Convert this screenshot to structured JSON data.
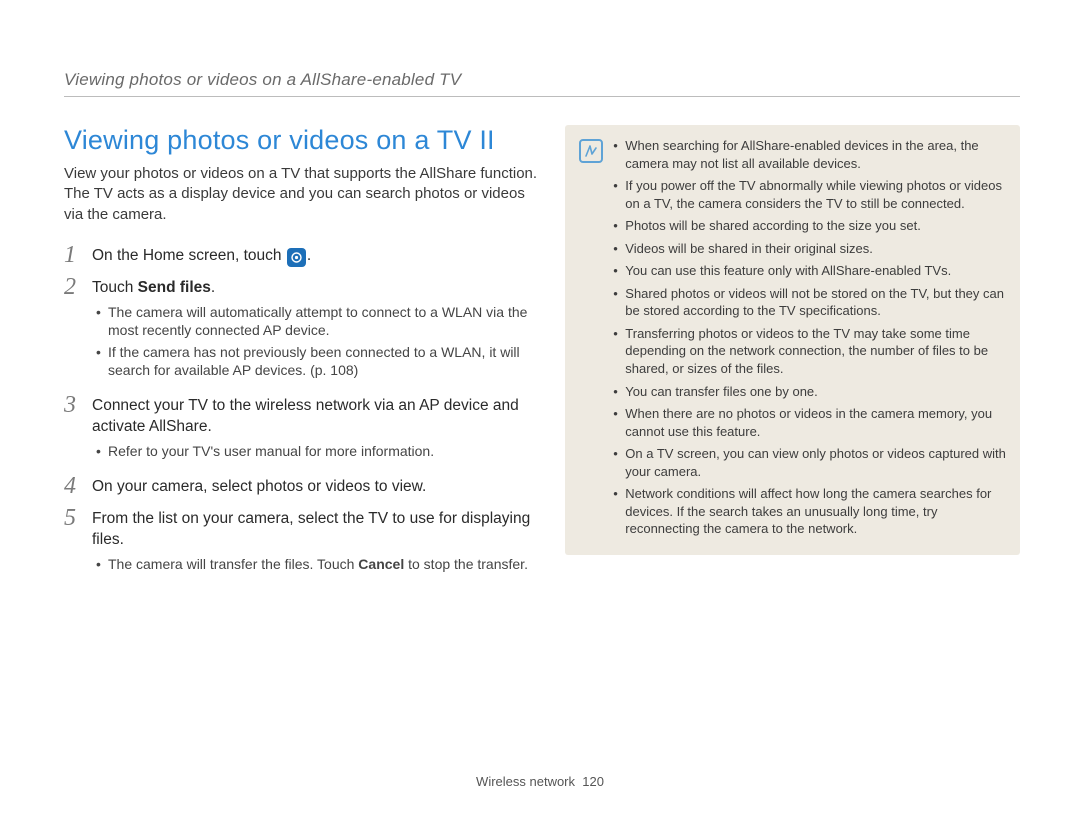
{
  "header": "Viewing photos or videos on a AllShare-enabled TV",
  "title": "Viewing photos or videos on a TV II",
  "intro": "View your photos or videos on a TV that supports the AllShare function. The TV acts as a display device and you can search photos or videos via the camera.",
  "steps": [
    {
      "num": "1",
      "pre": "On the Home screen, touch ",
      "post": "."
    },
    {
      "num": "2",
      "pre": "Touch ",
      "bold": "Send files",
      "post": ".",
      "subs": [
        "The camera will automatically attempt to connect to a WLAN via the most recently connected AP device.",
        "If the camera has not previously been connected to a WLAN, it will search for available AP devices. (p. 108)"
      ]
    },
    {
      "num": "3",
      "text": "Connect your TV to the wireless network via an AP device and activate AllShare.",
      "subs": [
        "Refer to your TV's user manual for more information."
      ]
    },
    {
      "num": "4",
      "text": "On your camera, select photos or videos to view."
    },
    {
      "num": "5",
      "text": "From the list on your camera, select the TV to use for displaying files.",
      "subs_rich": {
        "pre": "The camera will transfer the files. Touch ",
        "bold": "Cancel",
        "post": " to stop the transfer."
      }
    }
  ],
  "notes": [
    "When searching for AllShare-enabled devices in the area, the camera may not list all available devices.",
    "If you power off the TV abnormally while viewing photos or videos on a TV, the camera considers the TV to still be connected.",
    "Photos will be shared according to the size you set.",
    "Videos will be shared in their original sizes.",
    "You can use this feature only with AllShare-enabled TVs.",
    "Shared photos or videos will not be stored on the TV, but they can be stored according to the TV specifications.",
    "Transferring photos or videos to the TV may take some time depending on the network connection, the number of files to be shared, or sizes of the files.",
    "You can transfer files one by one.",
    "When there are no photos or videos in the camera memory, you cannot use this feature.",
    "On a TV screen, you can view only photos or videos captured with your camera.",
    "Network conditions will affect how long the camera searches for devices. If the search takes an unusually long time, try reconnecting the camera to the network."
  ],
  "footer": {
    "section": "Wireless network",
    "page": "120"
  }
}
